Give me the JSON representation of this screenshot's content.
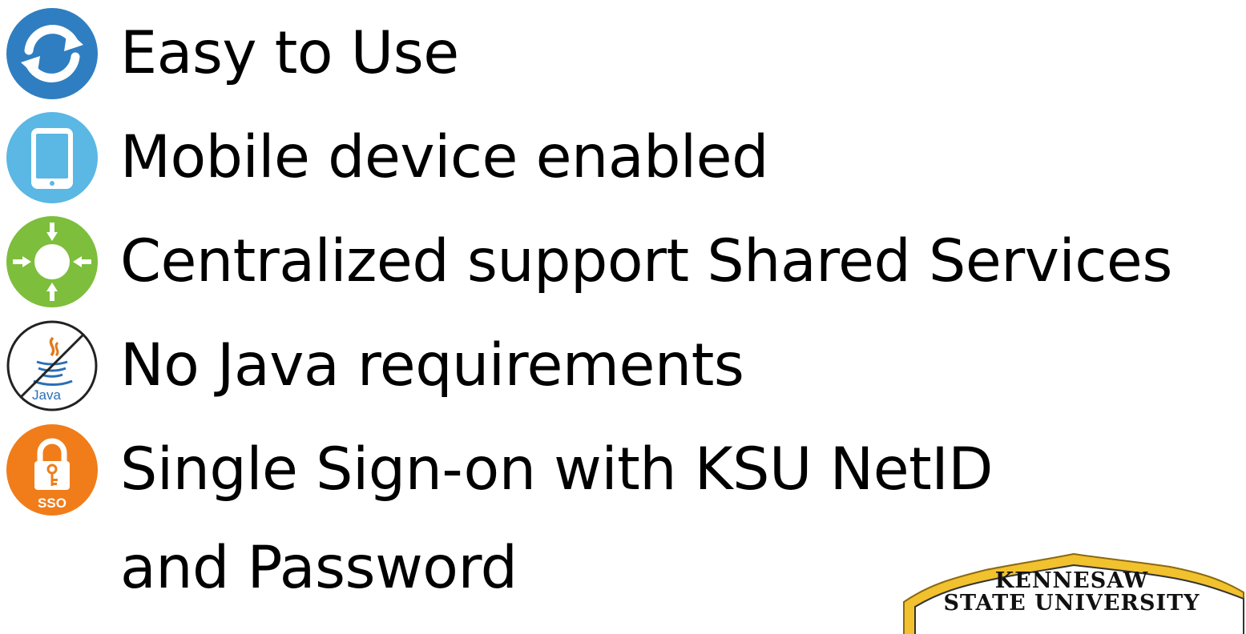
{
  "features": [
    {
      "label": "Easy to Use",
      "icon": "sync-icon",
      "color": "#2F7EC1"
    },
    {
      "label": "Mobile device enabled",
      "icon": "tablet-icon",
      "color": "#5BB7E3"
    },
    {
      "label": "Centralized support Shared Services",
      "icon": "centralize-icon",
      "color": "#7DBE3C"
    },
    {
      "label": "No Java requirements",
      "icon": "no-java-icon",
      "color": "#E07A1C"
    },
    {
      "label": "Single Sign-on with KSU NetID",
      "icon": "sso-lock-icon",
      "color": "#F07D1A"
    }
  ],
  "continuation": "and Password",
  "logo": {
    "line1": "KENNESAW",
    "line2": "STATE UNIVERSITY",
    "accent": "#F2C12E"
  },
  "icon_text": {
    "java": "Java",
    "sso": "SSO"
  }
}
